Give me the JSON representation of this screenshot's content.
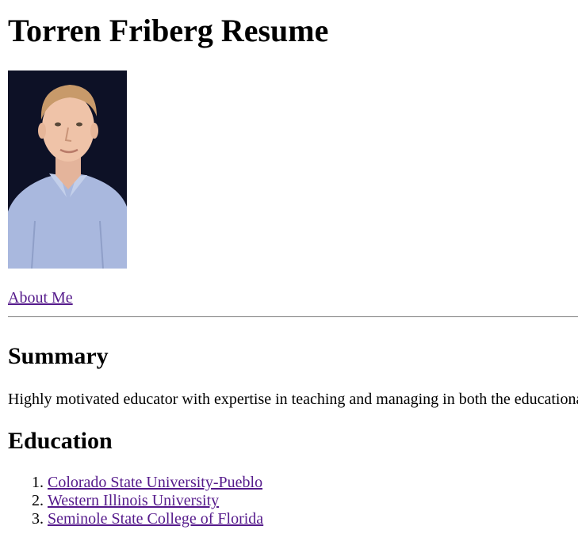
{
  "page": {
    "title": "Torren Friberg Resume"
  },
  "nav": {
    "about_label": "About Me"
  },
  "summary": {
    "heading": "Summary",
    "text": "Highly motivated educator with expertise in teaching and managing in both the educational"
  },
  "education": {
    "heading": "Education",
    "schools": [
      {
        "name": "Colorado State University-Pueblo"
      },
      {
        "name": "Western Illinois University"
      },
      {
        "name": "Seminole State College of Florida"
      }
    ]
  },
  "colors": {
    "link": "#551a8b",
    "photo_background": "#0d1126",
    "shirt": "#a9b8de"
  }
}
